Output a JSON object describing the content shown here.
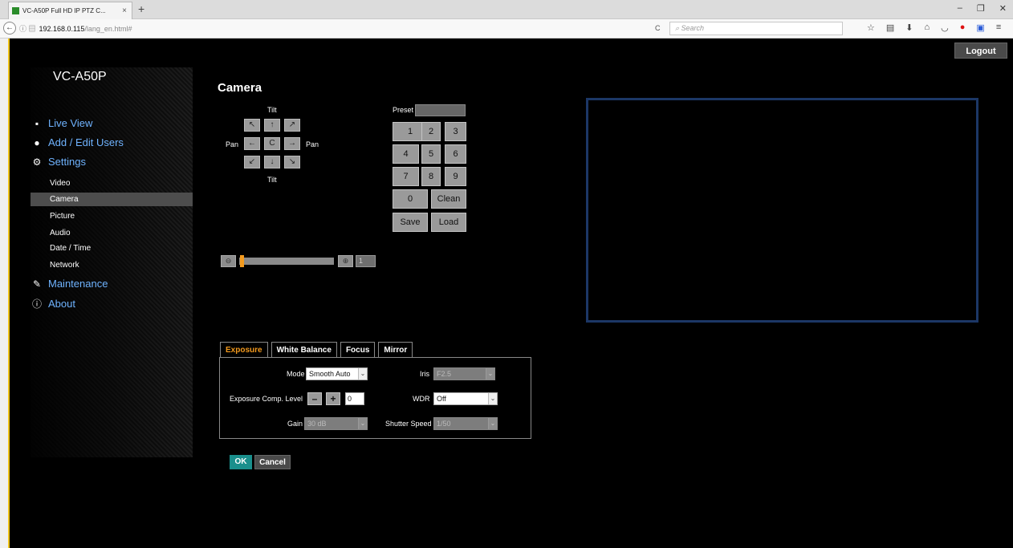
{
  "browser": {
    "tab_title": "VC-A50P Full HD IP PTZ C...",
    "tab_close": "×",
    "new_tab": "+",
    "back": "←",
    "url_host": "192.168.0.115",
    "url_path": "/lang_en.html#",
    "reload": "C",
    "search_placeholder": "Search",
    "search_icon": "search-icon",
    "nav_icons": [
      "☆",
      "▤",
      "⬇",
      "⌂",
      "◡",
      "●",
      "▣",
      "≡"
    ],
    "window_controls": [
      "–",
      "❐",
      "✕"
    ]
  },
  "header": {
    "logout": "Logout"
  },
  "sidebar": {
    "model": "VC-A50P",
    "main_items": [
      {
        "label": "Live View",
        "icon": "video-camera-icon",
        "glyph": "▪"
      },
      {
        "label": "Add / Edit Users",
        "icon": "user-icon",
        "glyph": "●"
      },
      {
        "label": "Settings",
        "icon": "gear-icon",
        "glyph": "⚙"
      },
      {
        "label": "Maintenance",
        "icon": "wrench-icon",
        "glyph": "✎"
      },
      {
        "label": "About",
        "icon": "info-icon",
        "glyph": "ⓘ"
      }
    ],
    "sub_items": [
      "Video",
      "Camera",
      "Picture",
      "Audio",
      "Date / Time",
      "Network"
    ],
    "active_sub": "Camera"
  },
  "camera": {
    "title": "Camera",
    "tilt": "Tilt",
    "pan": "Pan",
    "directions": {
      "up_left": "↖",
      "up": "↑",
      "up_right": "↗",
      "left": "←",
      "center": "C",
      "right": "→",
      "down_left": "↙",
      "down": "↓",
      "down_right": "↘"
    },
    "preset_label": "Preset",
    "preset_value": "",
    "keypad": [
      "1",
      "2",
      "3",
      "4",
      "5",
      "6",
      "7",
      "8",
      "9",
      "0",
      "Clean",
      "Save",
      "Load"
    ],
    "zoom": {
      "minus_icon": "⊖",
      "plus_icon": "⊕",
      "value": "1",
      "level_fraction": 0.0
    }
  },
  "tabs": [
    "Exposure",
    "White Balance",
    "Focus",
    "Mirror"
  ],
  "active_tab": "Exposure",
  "exposure": {
    "mode_label": "Mode",
    "mode_value": "Smooth Auto",
    "iris_label": "Iris",
    "iris_value": "F2.5",
    "comp_label": "Exposure Comp. Level",
    "comp_minus": "–",
    "comp_plus": "+",
    "comp_value": "0",
    "wdr_label": "WDR",
    "wdr_value": "Off",
    "gain_label": "Gain",
    "gain_value": "30 dB",
    "shutter_label": "Shutter Speed",
    "shutter_value": "1/50",
    "caret": "⌄"
  },
  "actions": {
    "ok": "OK",
    "cancel": "Cancel"
  },
  "colors": {
    "accent": "#f39a1e",
    "ok": "#1a8f8c",
    "link": "#6fb3ff",
    "preview_border": "#1c3766"
  }
}
